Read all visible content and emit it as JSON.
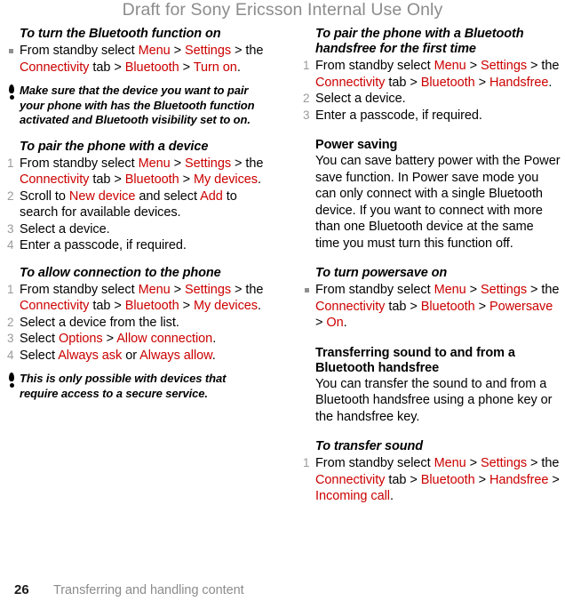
{
  "header": {
    "watermark": "Draft for Sony Ericsson Internal Use Only"
  },
  "colors": {
    "ui_reference": "#cc0000",
    "watermark": "#8c8c8c",
    "marker": "#9a9a9a",
    "body": "#000000"
  },
  "left_column": {
    "section1": {
      "heading": "To turn the Bluetooth function on",
      "steps": [
        "From standby select Menu > Settings > the Connectivity tab > Bluetooth > Turn on."
      ],
      "step1_parts": {
        "t1": "From standby select ",
        "ui1": "Menu",
        "t2": " > ",
        "ui2": "Settings",
        "t3": " > the ",
        "ui3": "Connectivity",
        "t4": " tab > ",
        "ui4": "Bluetooth",
        "t5": " > ",
        "ui5": "Turn on",
        "t6": "."
      }
    },
    "tip1": {
      "icon": "exclamation-icon",
      "text": "Make sure that the device you want to pair your phone with has the Bluetooth function activated and Bluetooth visibility set to on."
    },
    "section2": {
      "heading": "To pair the phone with a device",
      "step1": {
        "t1": "From standby select ",
        "ui1": "Menu",
        "t2": " > ",
        "ui2": "Settings",
        "t3": " > the ",
        "ui3": "Connectivity",
        "t4": " tab > ",
        "ui4": "Bluetooth",
        "t5": " > ",
        "ui5": "My devices",
        "t6": "."
      },
      "step2": {
        "t1": "Scroll to ",
        "ui1": "New device",
        "t2": " and select ",
        "ui2": "Add",
        "t3": " to search for available devices."
      },
      "step3": "Select a device.",
      "step4": "Enter a passcode, if required.",
      "markers": [
        "1",
        "2",
        "3",
        "4"
      ]
    },
    "section3": {
      "heading": "To allow connection to the phone",
      "step1": {
        "t1": "From standby select ",
        "ui1": "Menu",
        "t2": " > ",
        "ui2": "Settings",
        "t3": " > the ",
        "ui3": "Connectivity",
        "t4": " tab > ",
        "ui4": "Bluetooth",
        "t5": " > ",
        "ui5": "My devices",
        "t6": "."
      },
      "step2": "Select a device from the list.",
      "step3": {
        "t1": "Select ",
        "ui1": "Options",
        "t2": " > ",
        "ui2": "Allow connection",
        "t3": "."
      },
      "step4": {
        "t1": "Select ",
        "ui1": "Always ask",
        "t2": " or ",
        "ui2": "Always allow",
        "t3": "."
      },
      "markers": [
        "1",
        "2",
        "3",
        "4"
      ]
    },
    "tip2": {
      "icon": "exclamation-icon",
      "text": "This is only possible with devices that require access to a secure service."
    }
  },
  "right_column": {
    "section1": {
      "heading": "To pair the phone with a Bluetooth handsfree for the first time",
      "step1": {
        "t1": "From standby select ",
        "ui1": "Menu",
        "t2": " > ",
        "ui2": "Settings",
        "t3": " > the ",
        "ui3": "Connectivity",
        "t4": " tab > ",
        "ui4": "Bluetooth",
        "t5": " > ",
        "ui5": "Handsfree",
        "t6": "."
      },
      "step2": "Select a device.",
      "step3": "Enter a passcode, if required.",
      "markers": [
        "1",
        "2",
        "3"
      ]
    },
    "section2": {
      "heading": "Power saving",
      "body": "You can save battery power with the Power save function. In Power save mode you can only connect with a single Bluetooth device. If you want to connect with more than one Bluetooth device at the same time you must turn this function off."
    },
    "section3": {
      "heading": "To turn powersave on",
      "step1": {
        "t1": "From standby select ",
        "ui1": "Menu",
        "t2": " > ",
        "ui2": "Settings",
        "t3": " > the ",
        "ui3": "Connectivity",
        "t4": " tab > ",
        "ui4": "Bluetooth",
        "t5": " > ",
        "ui5": "Powersave",
        "t6": " > ",
        "ui6": "On",
        "t7": "."
      }
    },
    "section4": {
      "heading": "Transferring sound to and from a Bluetooth handsfree",
      "body": "You can transfer the sound to and from a Bluetooth handsfree using a phone key or the handsfree key."
    },
    "section5": {
      "heading": "To transfer sound",
      "step1": {
        "t1": "From standby select ",
        "ui1": "Menu",
        "t2": " > ",
        "ui2": "Settings",
        "t3": " > the ",
        "ui3": "Connectivity",
        "t4": " tab > ",
        "ui4": "Bluetooth",
        "t5": " > ",
        "ui5": "Handsfree",
        "t6": " > ",
        "ui6": "Incoming call",
        "t7": "."
      },
      "markers": [
        "1"
      ]
    }
  },
  "footer": {
    "page_number": "26",
    "chapter": "Transferring and handling content"
  }
}
